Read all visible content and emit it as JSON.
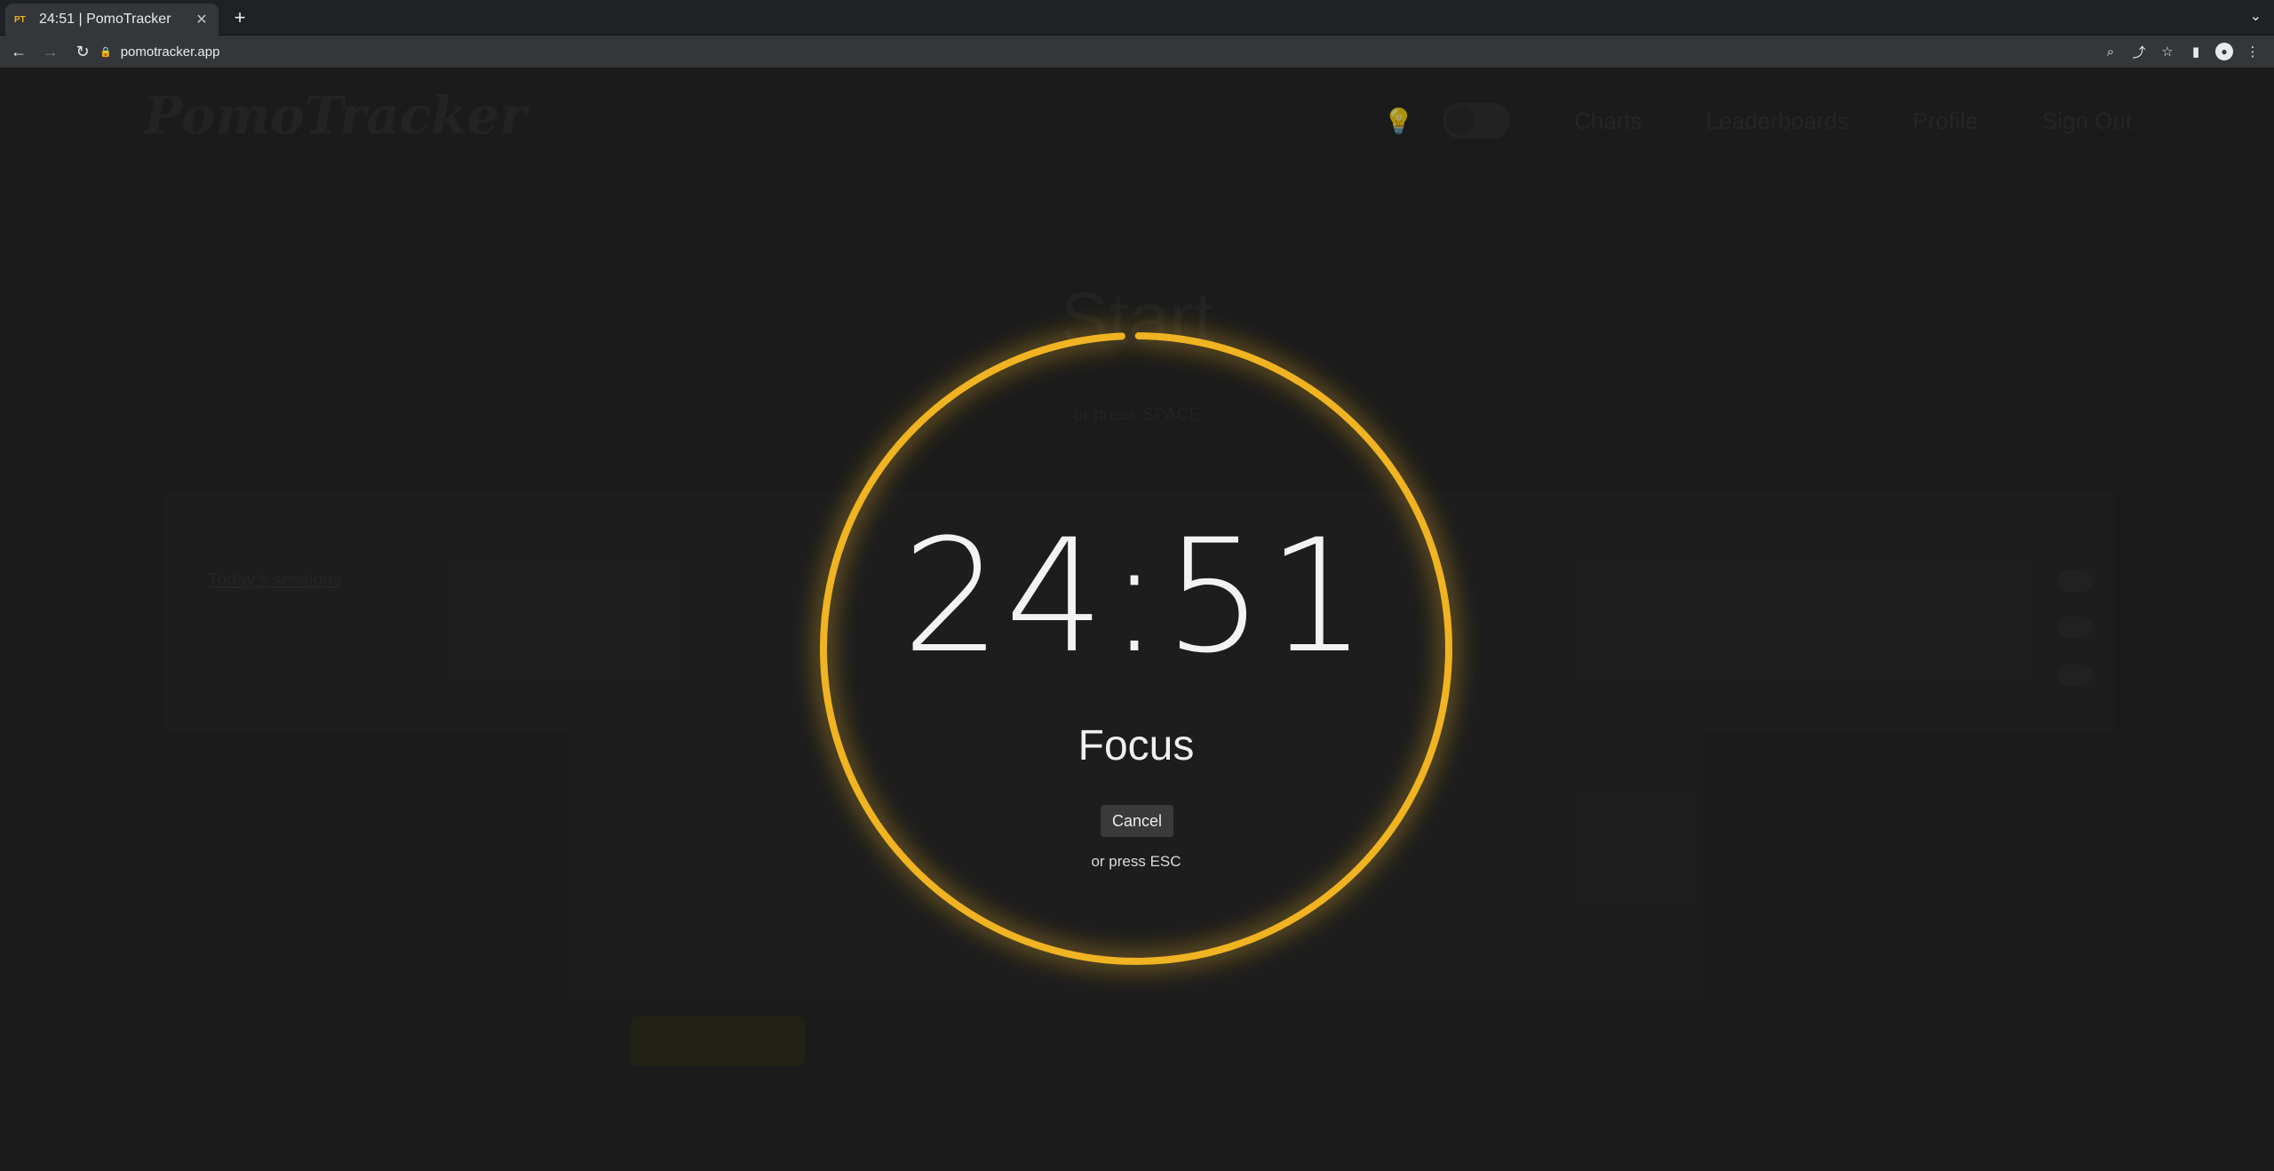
{
  "browser": {
    "tab_title": "24:51 | PomoTracker",
    "favicon_text": "PT",
    "url": "pomotracker.app"
  },
  "background": {
    "logo": "PomoTracker",
    "nav": [
      "Charts",
      "Leaderboards",
      "Profile",
      "Sign Out"
    ],
    "start_title": "Start",
    "start_sub": "or press SPACE",
    "history_link": "Today's sessions"
  },
  "timer": {
    "time": "24:51",
    "mode": "Focus",
    "cancel_label": "Cancel",
    "esc_hint": "or press ESC",
    "progress_remaining_fraction": 0.994,
    "ring_color": "#f0b323"
  },
  "colors": {
    "accent": "#f0b323",
    "page_bg": "#1f1f1f"
  }
}
